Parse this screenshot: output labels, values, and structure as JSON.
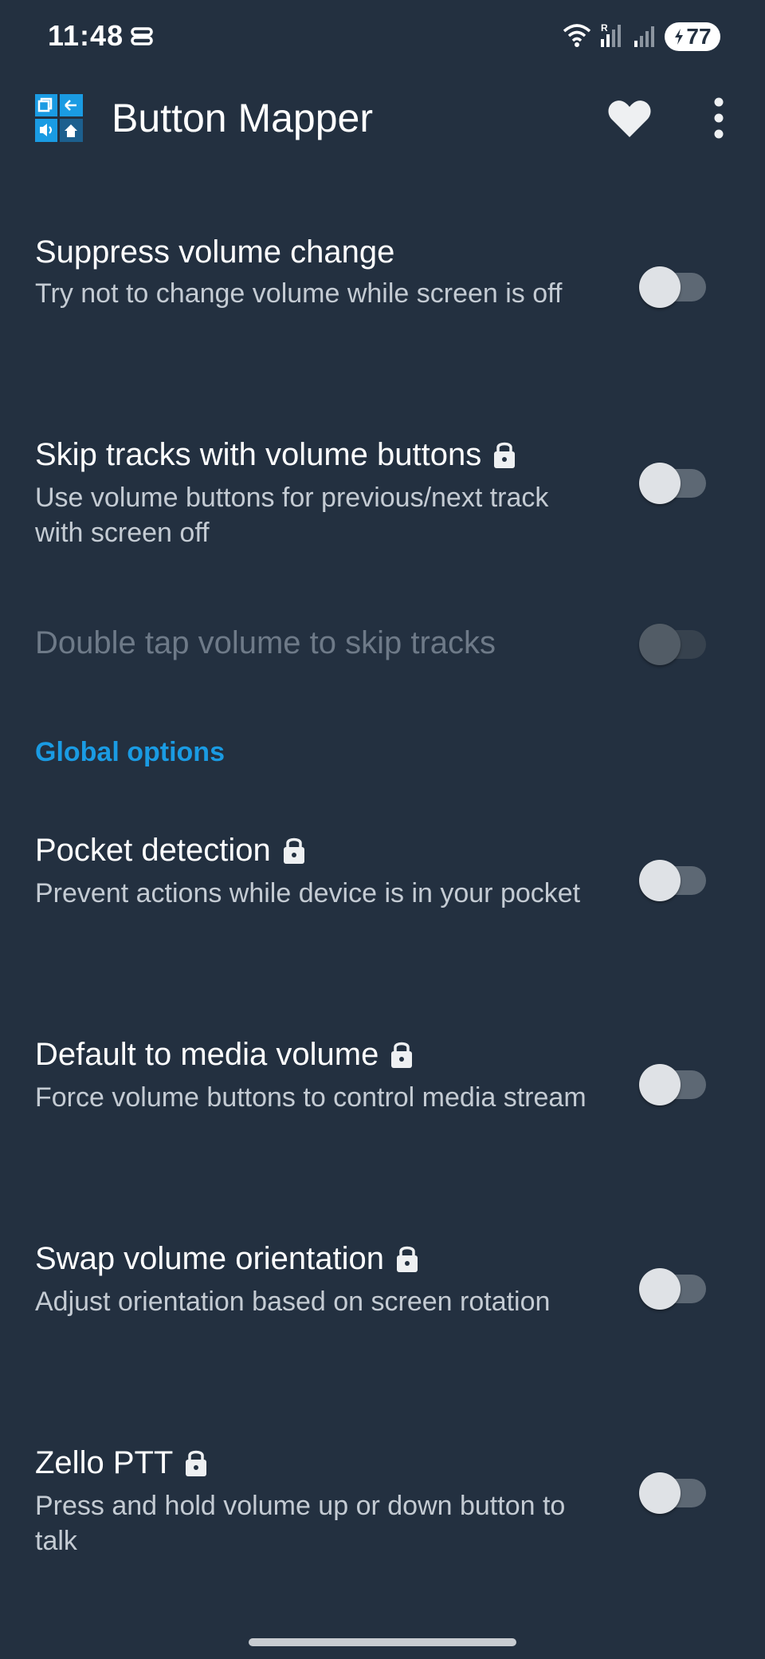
{
  "status_bar": {
    "time": "11:48",
    "battery": "77"
  },
  "app_bar": {
    "title": "Button Mapper"
  },
  "settings": [
    {
      "title": "Suppress volume change",
      "summary": "Try not to change volume while screen is off",
      "locked": false,
      "enabled": true,
      "checked": false
    },
    {
      "title": "Skip tracks with volume buttons",
      "summary": "Use volume buttons for previous/next track with screen off",
      "locked": true,
      "enabled": true,
      "checked": false
    },
    {
      "title": "Double tap volume to skip tracks",
      "summary": "",
      "locked": false,
      "enabled": false,
      "checked": false
    }
  ],
  "global_section": {
    "header": "Global options",
    "settings": [
      {
        "title": "Pocket detection",
        "summary": "Prevent actions while device is in your pocket",
        "locked": true,
        "enabled": true,
        "checked": false
      },
      {
        "title": "Default to media volume",
        "summary": "Force volume buttons to control media stream",
        "locked": true,
        "enabled": true,
        "checked": false
      },
      {
        "title": "Swap volume orientation",
        "summary": "Adjust orientation based on screen rotation",
        "locked": true,
        "enabled": true,
        "checked": false
      },
      {
        "title": "Zello PTT",
        "summary": "Press and hold volume up or down button to talk",
        "locked": true,
        "enabled": true,
        "checked": false
      }
    ]
  },
  "colors": {
    "background": "#233040",
    "accent": "#1a9be3",
    "summary_text": "#c4cbd3",
    "disabled_text": "#6e7a88"
  },
  "icons": {
    "heart": "heart-icon",
    "more": "more-vert-icon",
    "lock": "lock-icon"
  }
}
